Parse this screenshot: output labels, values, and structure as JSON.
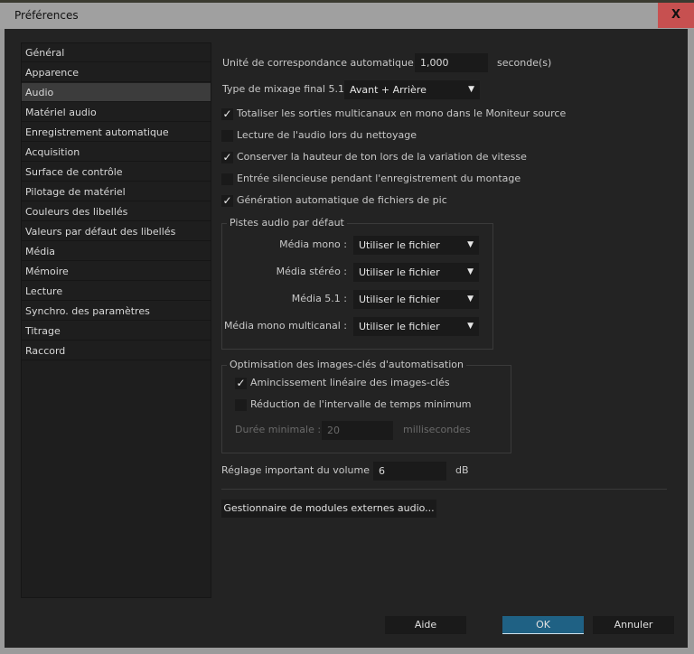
{
  "window": {
    "title": "Préférences",
    "close_label": "X"
  },
  "sidebar": {
    "items": [
      {
        "label": "Général"
      },
      {
        "label": "Apparence"
      },
      {
        "label": "Audio",
        "selected": true
      },
      {
        "label": "Matériel audio"
      },
      {
        "label": "Enregistrement automatique"
      },
      {
        "label": "Acquisition"
      },
      {
        "label": "Surface de contrôle"
      },
      {
        "label": "Pilotage de matériel"
      },
      {
        "label": "Couleurs des libellés"
      },
      {
        "label": "Valeurs par défaut des libellés"
      },
      {
        "label": "Média"
      },
      {
        "label": "Mémoire"
      },
      {
        "label": "Lecture"
      },
      {
        "label": "Synchro. des paramètres"
      },
      {
        "label": "Titrage"
      },
      {
        "label": "Raccord"
      }
    ]
  },
  "audio": {
    "auto_match": {
      "label": "Unité de correspondance automatique :",
      "value": "1,000",
      "unit": "seconde(s)"
    },
    "mix_type": {
      "label": "Type de mixage final 5.1 :",
      "value": "Avant + Arrière"
    },
    "checkboxes": [
      {
        "label": "Totaliser les sorties multicanaux en mono dans le Moniteur source",
        "checked": true
      },
      {
        "label": "Lecture de l'audio lors du nettoyage",
        "checked": false
      },
      {
        "label": "Conserver la hauteur de ton lors de la variation de vitesse",
        "checked": true
      },
      {
        "label": "Entrée silencieuse pendant l'enregistrement du montage",
        "checked": false
      },
      {
        "label": "Génération automatique de fichiers de pic",
        "checked": true
      }
    ],
    "default_tracks": {
      "title": "Pistes audio par défaut",
      "rows": [
        {
          "label": "Média mono :",
          "value": "Utiliser le fichier"
        },
        {
          "label": "Média stéréo :",
          "value": "Utiliser le fichier"
        },
        {
          "label": "Média 5.1 :",
          "value": "Utiliser le fichier"
        },
        {
          "label": "Média mono multicanal :",
          "value": "Utiliser le fichier"
        }
      ]
    },
    "keyframes": {
      "title": "Optimisation des images-clés d'automatisation",
      "thinning": {
        "label": "Amincissement linéaire des images-clés",
        "checked": true
      },
      "min_interval": {
        "label": "Réduction de l'intervalle de temps minimum",
        "checked": false
      },
      "min_duration": {
        "label": "Durée minimale :",
        "value": "20",
        "unit": "millisecondes"
      }
    },
    "volume": {
      "label": "Réglage important du volume :",
      "value": "6",
      "unit": "dB"
    },
    "plugin_manager_label": "Gestionnaire de modules externes audio..."
  },
  "footer": {
    "help": "Aide",
    "ok": "OK",
    "cancel": "Annuler"
  },
  "colors": {
    "ok_button": "#1f6184",
    "close_button": "#c75050"
  },
  "check_glyph": "✓"
}
